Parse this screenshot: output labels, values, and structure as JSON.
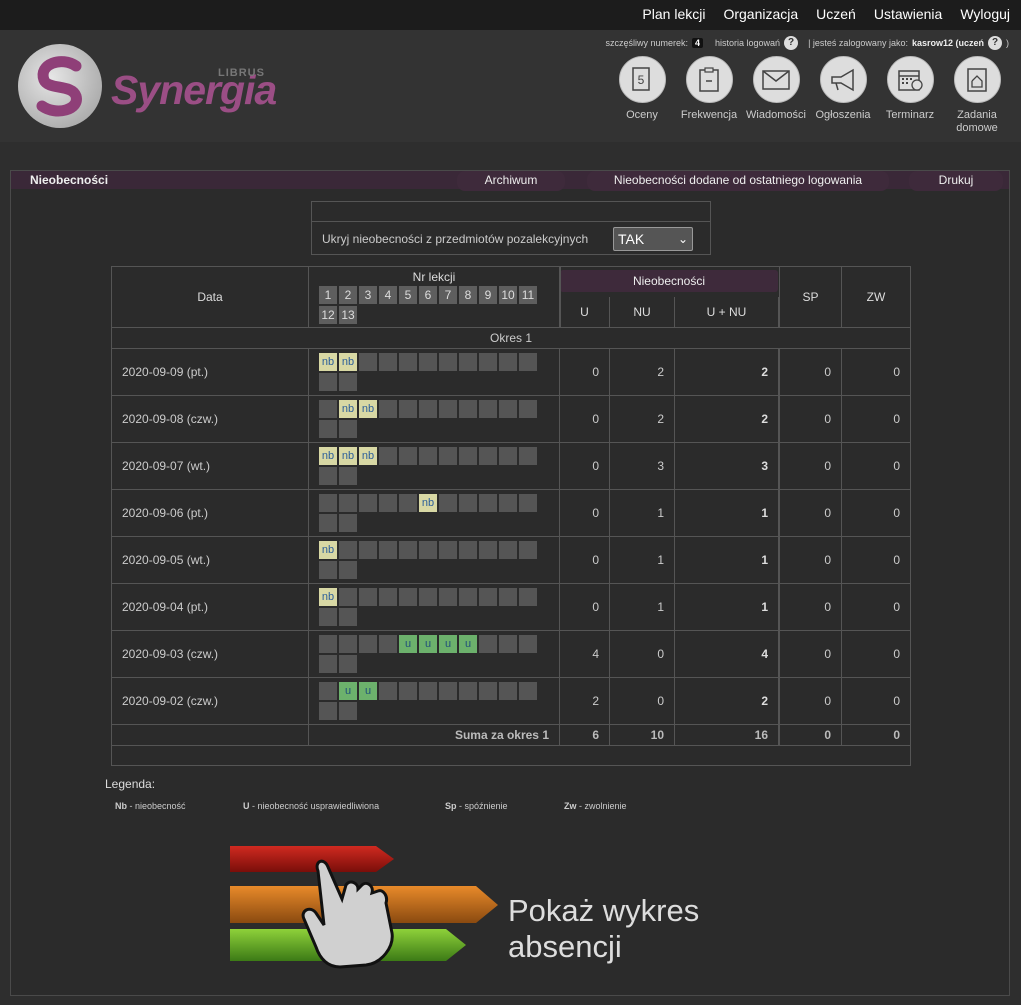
{
  "topnav": [
    "Plan lekcji",
    "Organizacja",
    "Uczeń",
    "Ustawienia",
    "Wyloguj"
  ],
  "logo": {
    "text": "Synergia",
    "librus": "LIBRUS"
  },
  "info": {
    "lucky_label": "szczęśliwy numerek:",
    "lucky_number": "4",
    "history": "historia logowań",
    "logged_label": "| jesteś zalogowany jako:",
    "user": "kasrow12 (uczeń",
    "close_paren": ")"
  },
  "quick": [
    {
      "label": "Oceny",
      "icon": "grades-icon"
    },
    {
      "label": "Frekwencja",
      "icon": "attendance-icon"
    },
    {
      "label": "Wiadomości",
      "icon": "envelope-icon"
    },
    {
      "label": "Ogłoszenia",
      "icon": "megaphone-icon"
    },
    {
      "label": "Terminarz",
      "icon": "calendar-icon"
    },
    {
      "label": "Zadania domowe",
      "icon": "homework-icon"
    }
  ],
  "tabs": {
    "main": "Nieobecności",
    "archive": "Archiwum",
    "since_login": "Nieobecności dodane od ostatniego logowania",
    "print": "Drukuj"
  },
  "filter": {
    "label": "Ukryj nieobecności z przedmiotów pozalekcyjnych",
    "value": "TAK"
  },
  "table": {
    "col_date": "Data",
    "col_lessons": "Nr lekcji",
    "lesson_numbers": [
      "1",
      "2",
      "3",
      "4",
      "5",
      "6",
      "7",
      "8",
      "9",
      "10",
      "11",
      "12",
      "13"
    ],
    "col_absences": "Nieobecności",
    "col_u": "U",
    "col_nu": "NU",
    "col_unu": "U + NU",
    "col_sp": "SP",
    "col_zw": "ZW",
    "period": "Okres 1",
    "rows": [
      {
        "date": "2020-09-09 (pt.)",
        "lessons": [
          "nb",
          "nb",
          "",
          "",
          "",
          "",
          "",
          "",
          "",
          "",
          "",
          "",
          ""
        ],
        "u": "0",
        "nu": "2",
        "unu": "2",
        "sp": "0",
        "zw": "0"
      },
      {
        "date": "2020-09-08 (czw.)",
        "lessons": [
          "",
          "nb",
          "nb",
          "",
          "",
          "",
          "",
          "",
          "",
          "",
          "",
          "",
          ""
        ],
        "u": "0",
        "nu": "2",
        "unu": "2",
        "sp": "0",
        "zw": "0"
      },
      {
        "date": "2020-09-07 (wt.)",
        "lessons": [
          "nb",
          "nb",
          "nb",
          "",
          "",
          "",
          "",
          "",
          "",
          "",
          "",
          "",
          ""
        ],
        "u": "0",
        "nu": "3",
        "unu": "3",
        "sp": "0",
        "zw": "0"
      },
      {
        "date": "2020-09-06 (pt.)",
        "lessons": [
          "",
          "",
          "",
          "",
          "",
          "nb",
          "",
          "",
          "",
          "",
          "",
          "",
          ""
        ],
        "u": "0",
        "nu": "1",
        "unu": "1",
        "sp": "0",
        "zw": "0"
      },
      {
        "date": "2020-09-05 (wt.)",
        "lessons": [
          "nb",
          "",
          "",
          "",
          "",
          "",
          "",
          "",
          "",
          "",
          "",
          "",
          ""
        ],
        "u": "0",
        "nu": "1",
        "unu": "1",
        "sp": "0",
        "zw": "0"
      },
      {
        "date": "2020-09-04 (pt.)",
        "lessons": [
          "nb",
          "",
          "",
          "",
          "",
          "",
          "",
          "",
          "",
          "",
          "",
          "",
          ""
        ],
        "u": "0",
        "nu": "1",
        "unu": "1",
        "sp": "0",
        "zw": "0"
      },
      {
        "date": "2020-09-03 (czw.)",
        "lessons": [
          "",
          "",
          "",
          "",
          "u",
          "u",
          "u",
          "u",
          "",
          "",
          "",
          "",
          ""
        ],
        "u": "4",
        "nu": "0",
        "unu": "4",
        "sp": "0",
        "zw": "0"
      },
      {
        "date": "2020-09-02 (czw.)",
        "lessons": [
          "",
          "u",
          "u",
          "",
          "",
          "",
          "",
          "",
          "",
          "",
          "",
          "",
          ""
        ],
        "u": "2",
        "nu": "0",
        "unu": "2",
        "sp": "0",
        "zw": "0"
      }
    ],
    "sum_label": "Suma za okres 1",
    "sum": {
      "u": "6",
      "nu": "10",
      "unu": "16",
      "sp": "0",
      "zw": "0"
    }
  },
  "legend": {
    "title": "Legenda:",
    "items": [
      {
        "key": "Nb",
        "desc": " - nieobecność"
      },
      {
        "key": "U",
        "desc": " - nieobecność usprawiedliwiona"
      },
      {
        "key": "Sp",
        "desc": " - spóźnienie"
      },
      {
        "key": "Zw",
        "desc": " - zwolnienie"
      }
    ]
  },
  "chart_link": "Pokaż wykres absencji",
  "colors": {
    "nb": "#d8d8a4",
    "u": "#6cb16c",
    "accent": "#9b4e85",
    "tabbar": "#3a2838"
  }
}
